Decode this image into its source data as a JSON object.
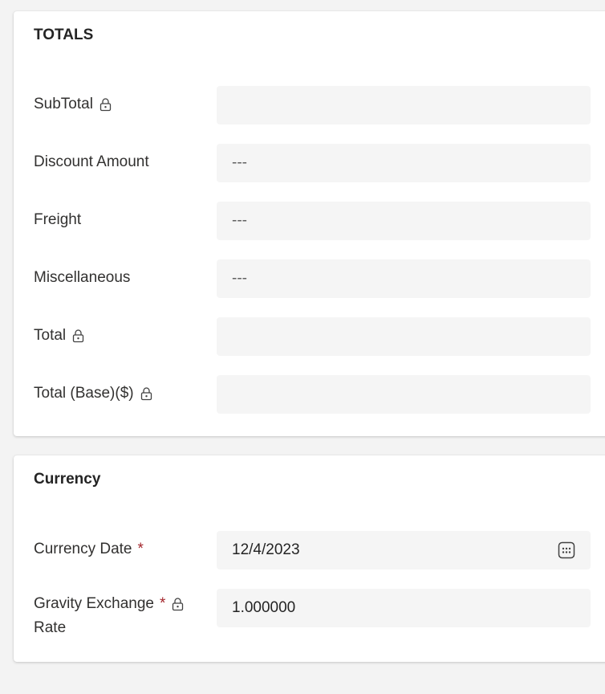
{
  "totals": {
    "title": "TOTALS",
    "fields": [
      {
        "label": "SubTotal",
        "value": "",
        "locked": true
      },
      {
        "label": "Discount Amount",
        "value": "---",
        "locked": false
      },
      {
        "label": "Freight",
        "value": "---",
        "locked": false
      },
      {
        "label": "Miscellaneous",
        "value": "---",
        "locked": false
      },
      {
        "label": "Total",
        "value": "",
        "locked": true
      },
      {
        "label": "Total (Base)($)",
        "value": "",
        "locked": true
      }
    ]
  },
  "currency": {
    "title": "Currency",
    "currency_date": {
      "label": "Currency Date",
      "required_mark": "*",
      "value": "12/4/2023",
      "icon": "calendar-icon"
    },
    "exchange_rate": {
      "label_line1": "Gravity Exchange",
      "label_line2": "Rate",
      "required_mark": "*",
      "value": "1.000000",
      "locked": true
    }
  },
  "colors": {
    "background": "#f3f3f3",
    "card": "#ffffff",
    "field": "#f5f5f5",
    "required": "#a4262c"
  }
}
